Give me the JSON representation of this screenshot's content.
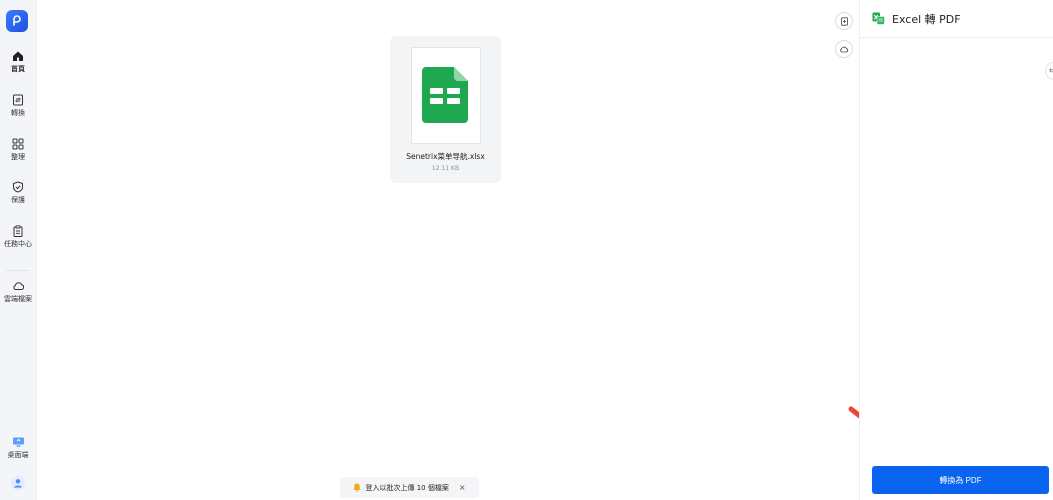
{
  "sidebar": {
    "items": [
      {
        "label": "首頁",
        "icon": "home-icon"
      },
      {
        "label": "轉換",
        "icon": "convert-icon"
      },
      {
        "label": "整理",
        "icon": "grid-icon"
      },
      {
        "label": "保護",
        "icon": "shield-icon"
      },
      {
        "label": "任務中心",
        "icon": "clipboard-icon"
      },
      {
        "label": "雲端檔案",
        "icon": "cloud-icon"
      }
    ],
    "bottom": [
      {
        "label": "桌面端",
        "icon": "desktop-icon"
      }
    ]
  },
  "file": {
    "name": "Senetrix菜单导航.xlsx",
    "size": "12.11 KB"
  },
  "notice": {
    "text": "登入以批次上傳 10 個檔案",
    "close": "×"
  },
  "panel": {
    "title": "Excel 轉 PDF",
    "convert_label": "轉換為 PDF",
    "edge_glyph": "⇆"
  },
  "colors": {
    "accent": "#0a64f0",
    "excel_green": "#1fa84f"
  }
}
